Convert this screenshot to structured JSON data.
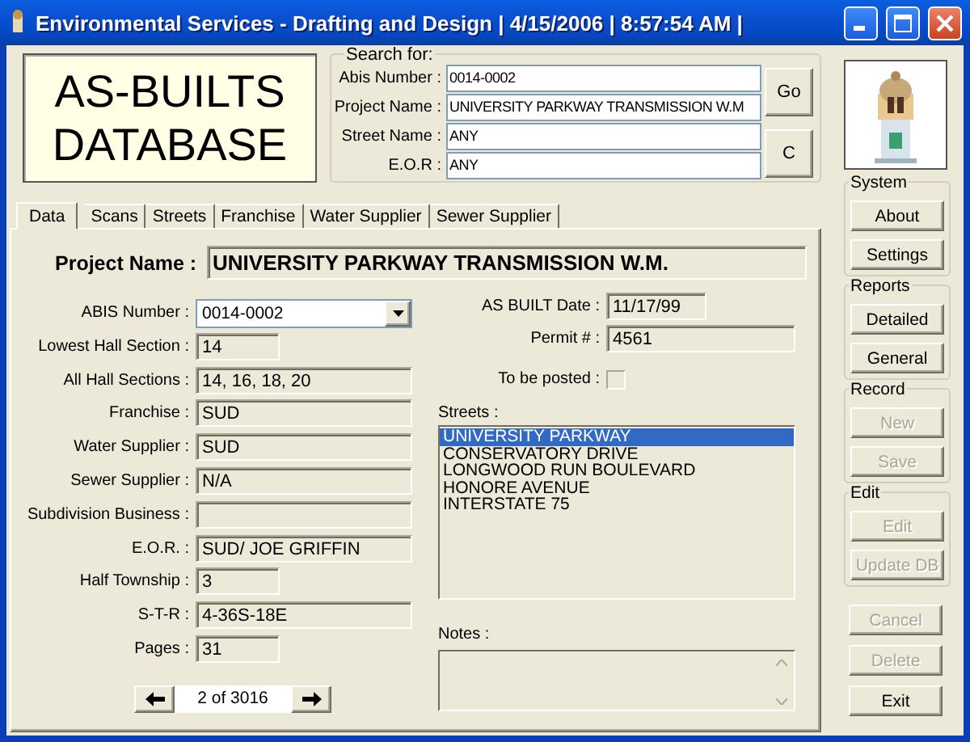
{
  "window": {
    "title": "Environmental Services - Drafting and Design | 4/15/2006 | 8:57:54 AM |"
  },
  "logo": {
    "lines": [
      "AS-BUILTS",
      "DATABASE"
    ]
  },
  "search": {
    "legend": "Search for:",
    "fields": [
      {
        "label": "Abis Number :",
        "value": "0014-0002"
      },
      {
        "label": "Project Name :",
        "value": "UNIVERSITY PARKWAY TRANSMISSION W.M"
      },
      {
        "label": "Street Name :",
        "value": "ANY"
      },
      {
        "label": "E.O.R :",
        "value": "ANY"
      }
    ],
    "buttons": [
      "Go",
      "C"
    ]
  },
  "tabs": [
    {
      "label": "Data",
      "selected": true
    },
    {
      "label": "Scans",
      "selected": false
    },
    {
      "label": "Streets",
      "selected": false
    },
    {
      "label": "Franchise",
      "selected": false
    },
    {
      "label": "Water Supplier",
      "selected": false
    },
    {
      "label": "Sewer Supplier",
      "selected": false
    }
  ],
  "project": {
    "label": "Project Name :",
    "value": "UNIVERSITY PARKWAY TRANSMISSION W.M."
  },
  "fields": [
    {
      "label": "ABIS Number :",
      "value": "0014-0002",
      "kind": "combo"
    },
    {
      "label": "Lowest Hall Section :",
      "value": "14",
      "kind": "short"
    },
    {
      "label": "All Hall Sections :",
      "value": "14, 16, 18, 20",
      "kind": "long"
    },
    {
      "label": "Franchise :",
      "value": "SUD",
      "kind": "long"
    },
    {
      "label": "Water Supplier :",
      "value": "SUD",
      "kind": "long"
    },
    {
      "label": "Sewer Supplier :",
      "value": "N/A",
      "kind": "long"
    },
    {
      "label": "Subdivision Business :",
      "kind": "long"
    },
    {
      "label": "E.O.R. :",
      "value": "SUD/ JOE GRIFFIN",
      "kind": "long"
    },
    {
      "label": "Half Township :",
      "value": "3",
      "kind": "short"
    },
    {
      "label": "S-T-R :",
      "value": "4-36S-18E",
      "kind": "long"
    },
    {
      "label": "Pages :",
      "value": "31",
      "kind": "short"
    }
  ],
  "details": [
    {
      "label": "AS BUILT Date :",
      "value": "11/17/99",
      "kind": "short"
    },
    {
      "label": "Permit # :",
      "value": "4561",
      "kind": "long"
    },
    {
      "label": "To be posted :",
      "kind": "checkbox",
      "checked": false
    }
  ],
  "streets": {
    "label": "Streets :",
    "items": [
      {
        "name": "UNIVERSITY PARKWAY",
        "selected": true
      },
      {
        "name": "CONSERVATORY DRIVE",
        "selected": false
      },
      {
        "name": "LONGWOOD RUN BOULEVARD",
        "selected": false
      },
      {
        "name": "HONORE AVENUE",
        "selected": false
      },
      {
        "name": "INTERSTATE 75",
        "selected": false
      }
    ]
  },
  "notes": {
    "label": "Notes :"
  },
  "navigator": {
    "position": "2 of 3016"
  },
  "side": {
    "groups": [
      {
        "title": "System",
        "buttons": [
          {
            "label": "About",
            "disabled": false
          },
          {
            "label": "Settings",
            "disabled": false
          }
        ]
      },
      {
        "title": "Reports",
        "buttons": [
          {
            "label": "Detailed",
            "disabled": false
          },
          {
            "label": "General",
            "disabled": false
          }
        ]
      },
      {
        "title": "Record",
        "buttons": [
          {
            "label": "New",
            "disabled": true
          },
          {
            "label": "Save",
            "disabled": true
          }
        ]
      },
      {
        "title": "Edit",
        "buttons": [
          {
            "label": "Edit",
            "disabled": true
          },
          {
            "label": "Update DB",
            "disabled": true
          }
        ]
      },
      {
        "buttons": [
          {
            "label": "Cancel",
            "disabled": true
          },
          {
            "label": "Delete",
            "disabled": true
          },
          {
            "label": "Exit",
            "disabled": false
          }
        ]
      }
    ]
  }
}
